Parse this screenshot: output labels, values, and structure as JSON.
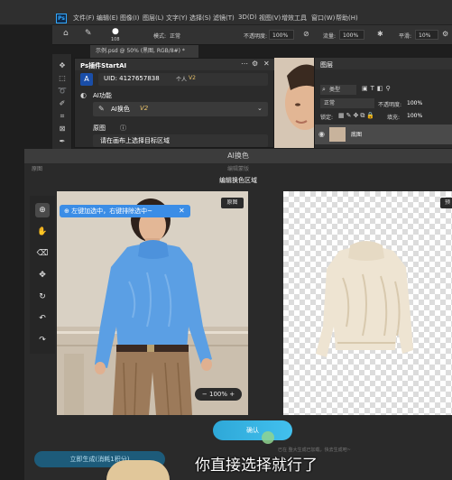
{
  "menubar": {
    "logo": "Ps",
    "items": [
      "文件(F)",
      "编辑(E)",
      "图像(I)",
      "图层(L)",
      "文字(Y)",
      "选择(S)",
      "滤镜(T)",
      "3D(D)",
      "视图(V)",
      "增效工具",
      "窗口(W)",
      "帮助(H)"
    ]
  },
  "options": {
    "size_value": "108",
    "mode_label": "模式:",
    "mode_value": "正常",
    "opacity_label": "不透明度:",
    "opacity_value": "100%",
    "flow_label": "流量:",
    "flow_value": "100%",
    "smooth_label": "平滑:",
    "smooth_value": "10%"
  },
  "document_tab": "示例.psd @ 50% (黑图, RGB/8#) *",
  "plugin": {
    "title": "Ps插件StartAI",
    "uid_label": "UID: 4127657838",
    "account_type": "个人",
    "version_badge": "V2",
    "ai_function_label": "AI功能",
    "ai_function_value": "AI换色",
    "ai_version": "V2",
    "original_label": "原图",
    "hint": "请在画布上选择目标区域"
  },
  "layers_panel": {
    "tab": "图层",
    "type_filter": "类型",
    "blend_mode": "正常",
    "opacity_label": "不透明度:",
    "opacity_value": "100%",
    "lock_label": "锁定:",
    "fill_label": "填充:",
    "fill_value": "100%",
    "layer_name": "底图"
  },
  "dialog": {
    "title": "AI换色",
    "sub_title": "编辑蒙版",
    "original_small": "原图",
    "edit_area_title": "编辑换色区域",
    "tip": "左键加选中，右键排除选中~",
    "original_badge": "原图",
    "preview_badge": "预",
    "zoom_value": "100%",
    "confirm_label": "确认",
    "bottom_button": "立即生成(消耗1积分)",
    "small_note": "已在 整大生成已加载，快去生成吧~"
  },
  "subtitle": "你直接选择就行了",
  "colors": {
    "accent": "#31a8ff",
    "sweater_selected": "#5aa0e6",
    "sweater_cream": "#eee4d2",
    "confirm": "#36b2e2"
  }
}
